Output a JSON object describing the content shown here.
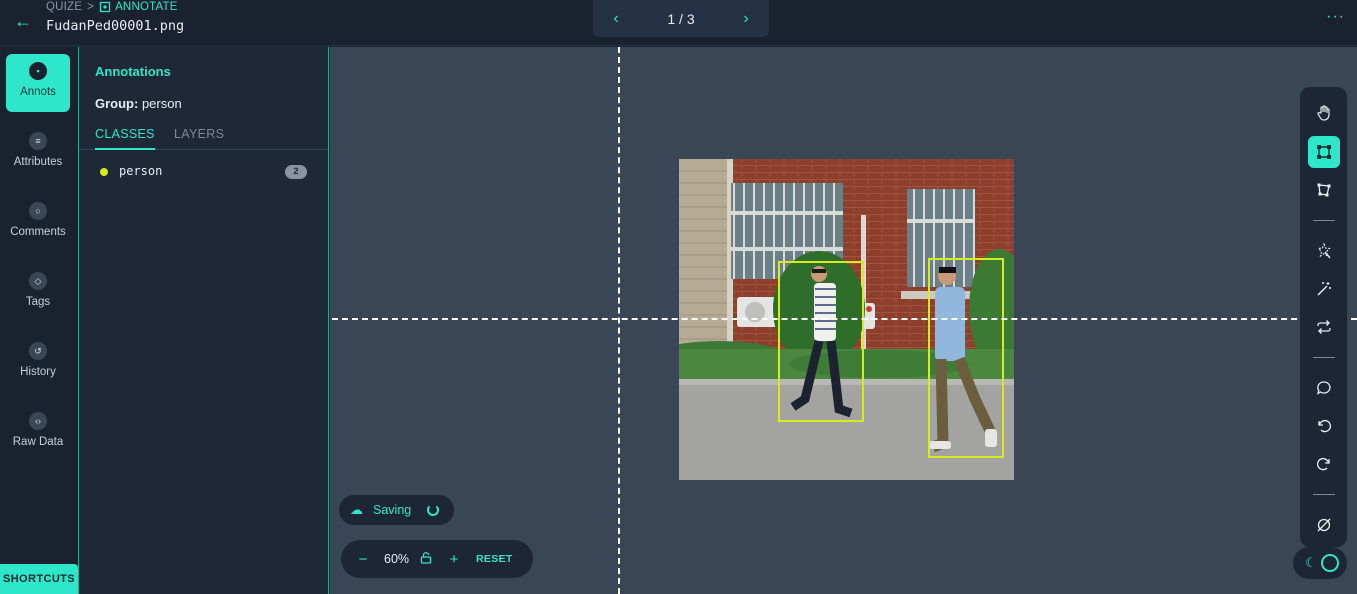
{
  "header": {
    "back_icon": "arrow-left-icon",
    "breadcrumb_root": "QUIZE",
    "breadcrumb_separator": ">",
    "breadcrumb_current": "ANNOTATE",
    "filename": "FudanPed00001.png",
    "pager": {
      "prev_icon": "chevron-left-icon",
      "counter": "1 / 3",
      "next_icon": "chevron-right-icon"
    },
    "more_icon": "more-horizontal-icon"
  },
  "rail": {
    "items": [
      {
        "label": "Annots",
        "icon": "annotation-icon",
        "active": true
      },
      {
        "label": "Attributes",
        "icon": "list-icon",
        "active": false
      },
      {
        "label": "Comments",
        "icon": "comment-icon",
        "active": false
      },
      {
        "label": "Tags",
        "icon": "tag-icon",
        "active": false
      },
      {
        "label": "History",
        "icon": "history-icon",
        "active": false
      },
      {
        "label": "Raw Data",
        "icon": "code-icon",
        "active": false
      }
    ],
    "shortcuts_label": "SHORTCUTS"
  },
  "panel": {
    "title": "Annotations",
    "group_label": "Group:",
    "group_value": "person",
    "tabs": [
      {
        "label": "CLASSES",
        "active": true
      },
      {
        "label": "LAYERS",
        "active": false
      }
    ],
    "classes": [
      {
        "name": "person",
        "count": "2",
        "color": "#d4ee1d"
      }
    ]
  },
  "canvas": {
    "image_name": "FudanPed00001.png",
    "box_color": "#d4ee1d",
    "saving_label": "Saving",
    "zoom": {
      "minus": "−",
      "value": "60%",
      "plus": "+",
      "reset": "RESET"
    }
  },
  "toolbar": {
    "tools": [
      "hand-icon",
      "bounding-box-icon",
      "polygon-icon",
      "magic-select-icon",
      "magic-wand-icon",
      "repeat-icon",
      "comment-icon",
      "undo-icon",
      "redo-icon",
      "clear-icon"
    ],
    "active": "bounding-box-icon"
  },
  "colors": {
    "accent": "#2ee6c9",
    "annotation": "#d4ee1d",
    "canvas_bg": "#3a4556"
  }
}
